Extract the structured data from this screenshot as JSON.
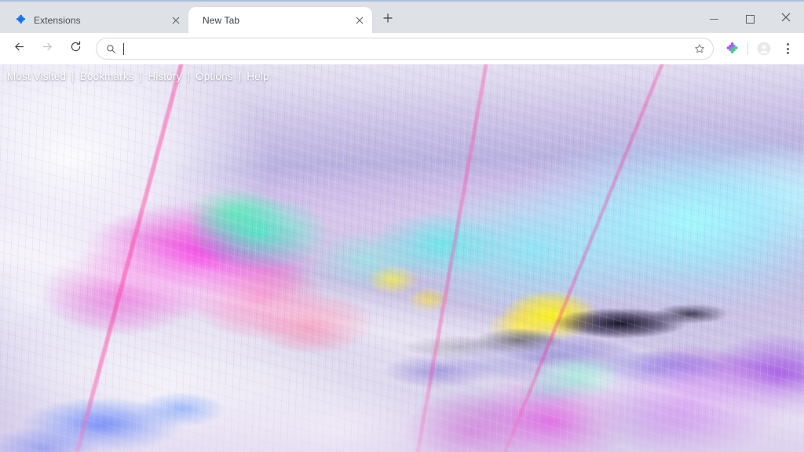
{
  "window": {
    "controls": [
      {
        "name": "minimize",
        "label": "—"
      },
      {
        "name": "maximize",
        "label": "□"
      },
      {
        "name": "close",
        "label": "✕"
      }
    ]
  },
  "tabstrip": {
    "tabs": [
      {
        "title": "Extensions",
        "favicon": "puzzle-piece-icon",
        "active": false,
        "close_label": "✕"
      },
      {
        "title": "New Tab",
        "favicon": "none",
        "active": true,
        "close_label": "✕"
      }
    ],
    "new_tab_button": {
      "label": "+",
      "icon": "plus-icon"
    }
  },
  "toolbar": {
    "back": {
      "icon": "back-arrow-icon",
      "label": "←",
      "enabled": true
    },
    "forward": {
      "icon": "forward-arrow-icon",
      "label": "→",
      "enabled": false
    },
    "reload": {
      "icon": "reload-icon",
      "label": "↻"
    },
    "omnibox": {
      "search_icon": "search-icon",
      "value": "",
      "placeholder": "",
      "star_icon": "star-icon"
    },
    "extensions_icon": "extensions-puzzle-icon",
    "profile_icon": "profile-avatar-icon",
    "menu_icon": "three-dot-menu-icon"
  },
  "bookmarks_bar": {
    "items": [
      "Most Visited",
      "Bookmarks",
      "History",
      "Options",
      "Help"
    ],
    "separator": "|"
  },
  "content": {
    "wallpaper_name": "abstract-colorful-glitch-landscape-wallpaper",
    "colors": {
      "magenta": "#ff28e6",
      "cyan": "#a0faff",
      "yellow": "#fff514",
      "blue": "#1950ff",
      "purple": "#af23eb",
      "green": "#14e6a0",
      "dark_ridge": "#08061a",
      "pale_lavender": "#e8e6f2"
    }
  }
}
